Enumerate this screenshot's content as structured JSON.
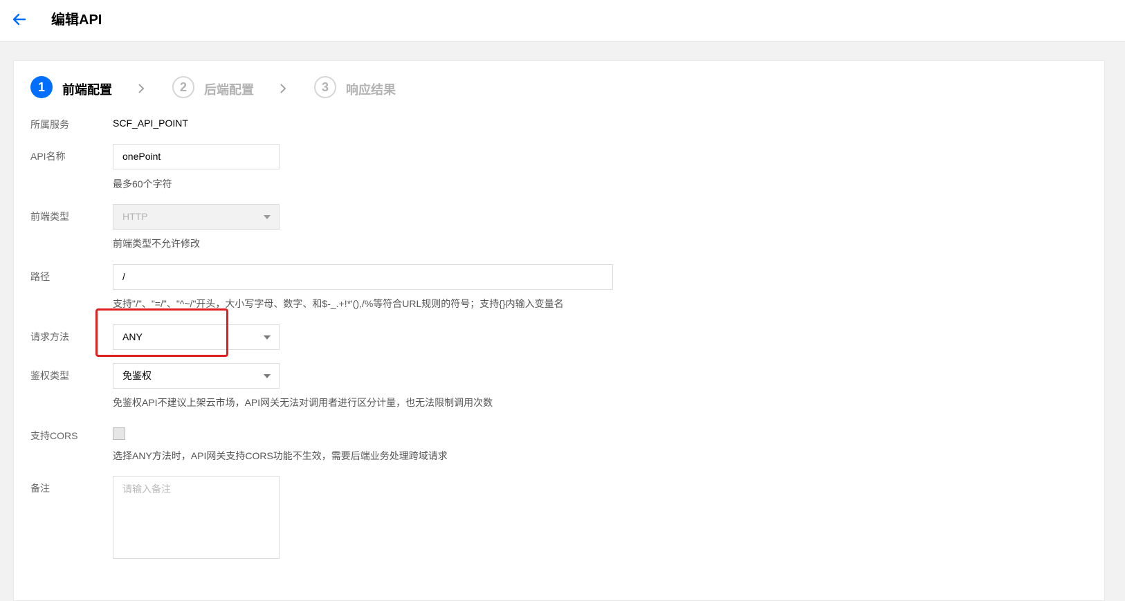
{
  "header": {
    "title": "编辑API"
  },
  "steps": [
    {
      "number": "1",
      "label": "前端配置"
    },
    {
      "number": "2",
      "label": "后端配置"
    },
    {
      "number": "3",
      "label": "响应结果"
    }
  ],
  "form": {
    "service": {
      "label": "所属服务",
      "value": "SCF_API_POINT"
    },
    "api_name": {
      "label": "API名称",
      "value": "onePoint",
      "hint": "最多60个字符"
    },
    "frontend_type": {
      "label": "前端类型",
      "value": "HTTP",
      "hint": "前端类型不允许修改"
    },
    "path": {
      "label": "路径",
      "value": "/",
      "hint": "支持\"/\"、\"=/\"、\"^~/\"开头，大小写字母、数字、和$-_.+!*'(),/%等符合URL规则的符号；支持{}内输入变量名"
    },
    "method": {
      "label": "请求方法",
      "value": "ANY"
    },
    "auth_type": {
      "label": "鉴权类型",
      "value": "免鉴权",
      "hint": "免鉴权API不建议上架云市场，API网关无法对调用者进行区分计量，也无法限制调用次数"
    },
    "cors": {
      "label": "支持CORS",
      "hint": "选择ANY方法时，API网关支持CORS功能不生效，需要后端业务处理跨域请求",
      "checked": false
    },
    "remark": {
      "label": "备注",
      "placeholder": "请输入备注"
    }
  }
}
